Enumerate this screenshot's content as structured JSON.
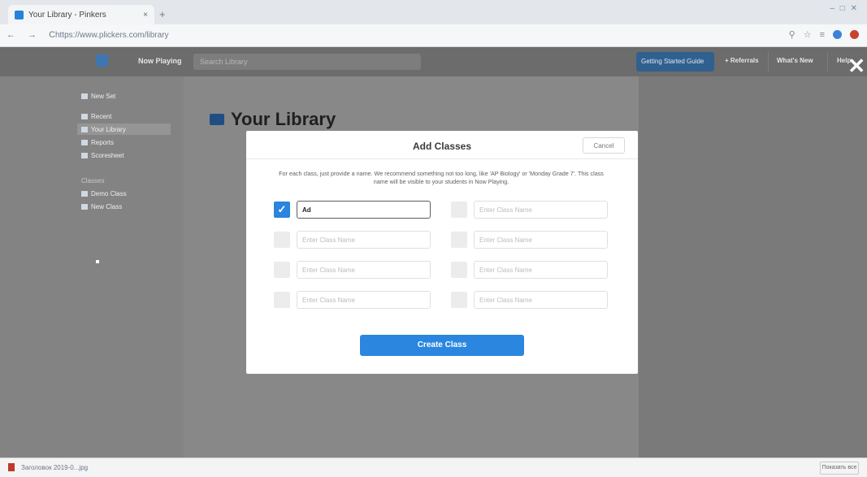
{
  "browser": {
    "tab_title": "Your Library - Pinkers",
    "tab_close": "×",
    "new_tab": "+",
    "window_controls": "‒ □ ✕",
    "nav_buttons": "← → C",
    "url": "https://www.plickers.com/library"
  },
  "app": {
    "now_playing": "Now Playing",
    "search_placeholder": "Search Library",
    "getting_started": "Getting Started Guide",
    "referral": "+ Referrals",
    "whats_new": "What's New",
    "help": "Help",
    "close_icon": "✕"
  },
  "sidebar": {
    "items": [
      {
        "label": "New Set"
      },
      {
        "label": "Recent"
      },
      {
        "label": "Your Library"
      },
      {
        "label": "Reports"
      },
      {
        "label": "Scoresheet"
      }
    ],
    "classes_heading": "Classes",
    "class_items": [
      {
        "label": "Demo Class"
      },
      {
        "label": "New Class"
      }
    ]
  },
  "main": {
    "title": "Your Library"
  },
  "modal": {
    "title": "Add Classes",
    "cancel_label": "Cancel",
    "description": "For each class, just provide a name. We recommend something not too long, like 'AP Biology' or 'Monday Grade 7'. This class name will be visible to your students in Now Playing.",
    "placeholder": "Enter Class Name",
    "rows": [
      {
        "left_value": "Ad",
        "left_checked": true
      },
      {},
      {},
      {}
    ],
    "create_label": "Create Class"
  },
  "downloads": {
    "file_name": "Заголовок 2019-0...jpg",
    "show_all": "Показать все"
  },
  "colors": {
    "accent": "#2b86df",
    "overlay": "#888888"
  }
}
